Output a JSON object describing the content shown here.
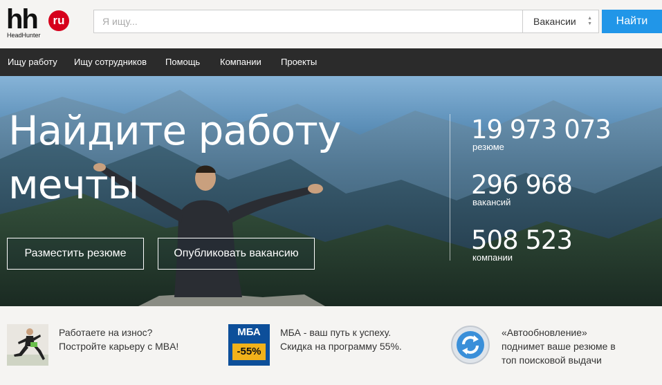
{
  "logo": {
    "main": "hh",
    "badge": "ru",
    "sub": "HeadHunter"
  },
  "search": {
    "placeholder": "Я ищу...",
    "value": "",
    "category": "Вакансии",
    "submit_label": "Найти"
  },
  "nav": {
    "items": [
      "Ищу работу",
      "Ищу сотрудников",
      "Помощь",
      "Компании",
      "Проекты"
    ]
  },
  "hero": {
    "title_line1": "Найдите работу",
    "title_line2": "мечты",
    "buttons": [
      "Разместить резюме",
      "Опубликовать вакансию"
    ],
    "stats": [
      {
        "value": "19 973 073",
        "label": "резюме"
      },
      {
        "value": "296 968",
        "label": "вакансий"
      },
      {
        "value": "508 523",
        "label": "компании"
      }
    ]
  },
  "promos": [
    {
      "line1": "Работаете на износ?",
      "line2": "Постройте карьеру с MBA!",
      "line3": ""
    },
    {
      "line1": "МБА - ваш путь к успеху.",
      "line2": "Скидка на программу 55%.",
      "line3": "",
      "badge_title": "МБА",
      "badge_discount": "-55%"
    },
    {
      "line1": "«Автообновление»",
      "line2": "поднимет ваше резюме в",
      "line3": "топ поисковой выдачи"
    }
  ],
  "colors": {
    "accent": "#2196e8",
    "nav_bg": "#2b2b2b",
    "logo_red": "#d6001c",
    "mba_blue": "#0d4f9a",
    "mba_yellow": "#f2b21a"
  }
}
